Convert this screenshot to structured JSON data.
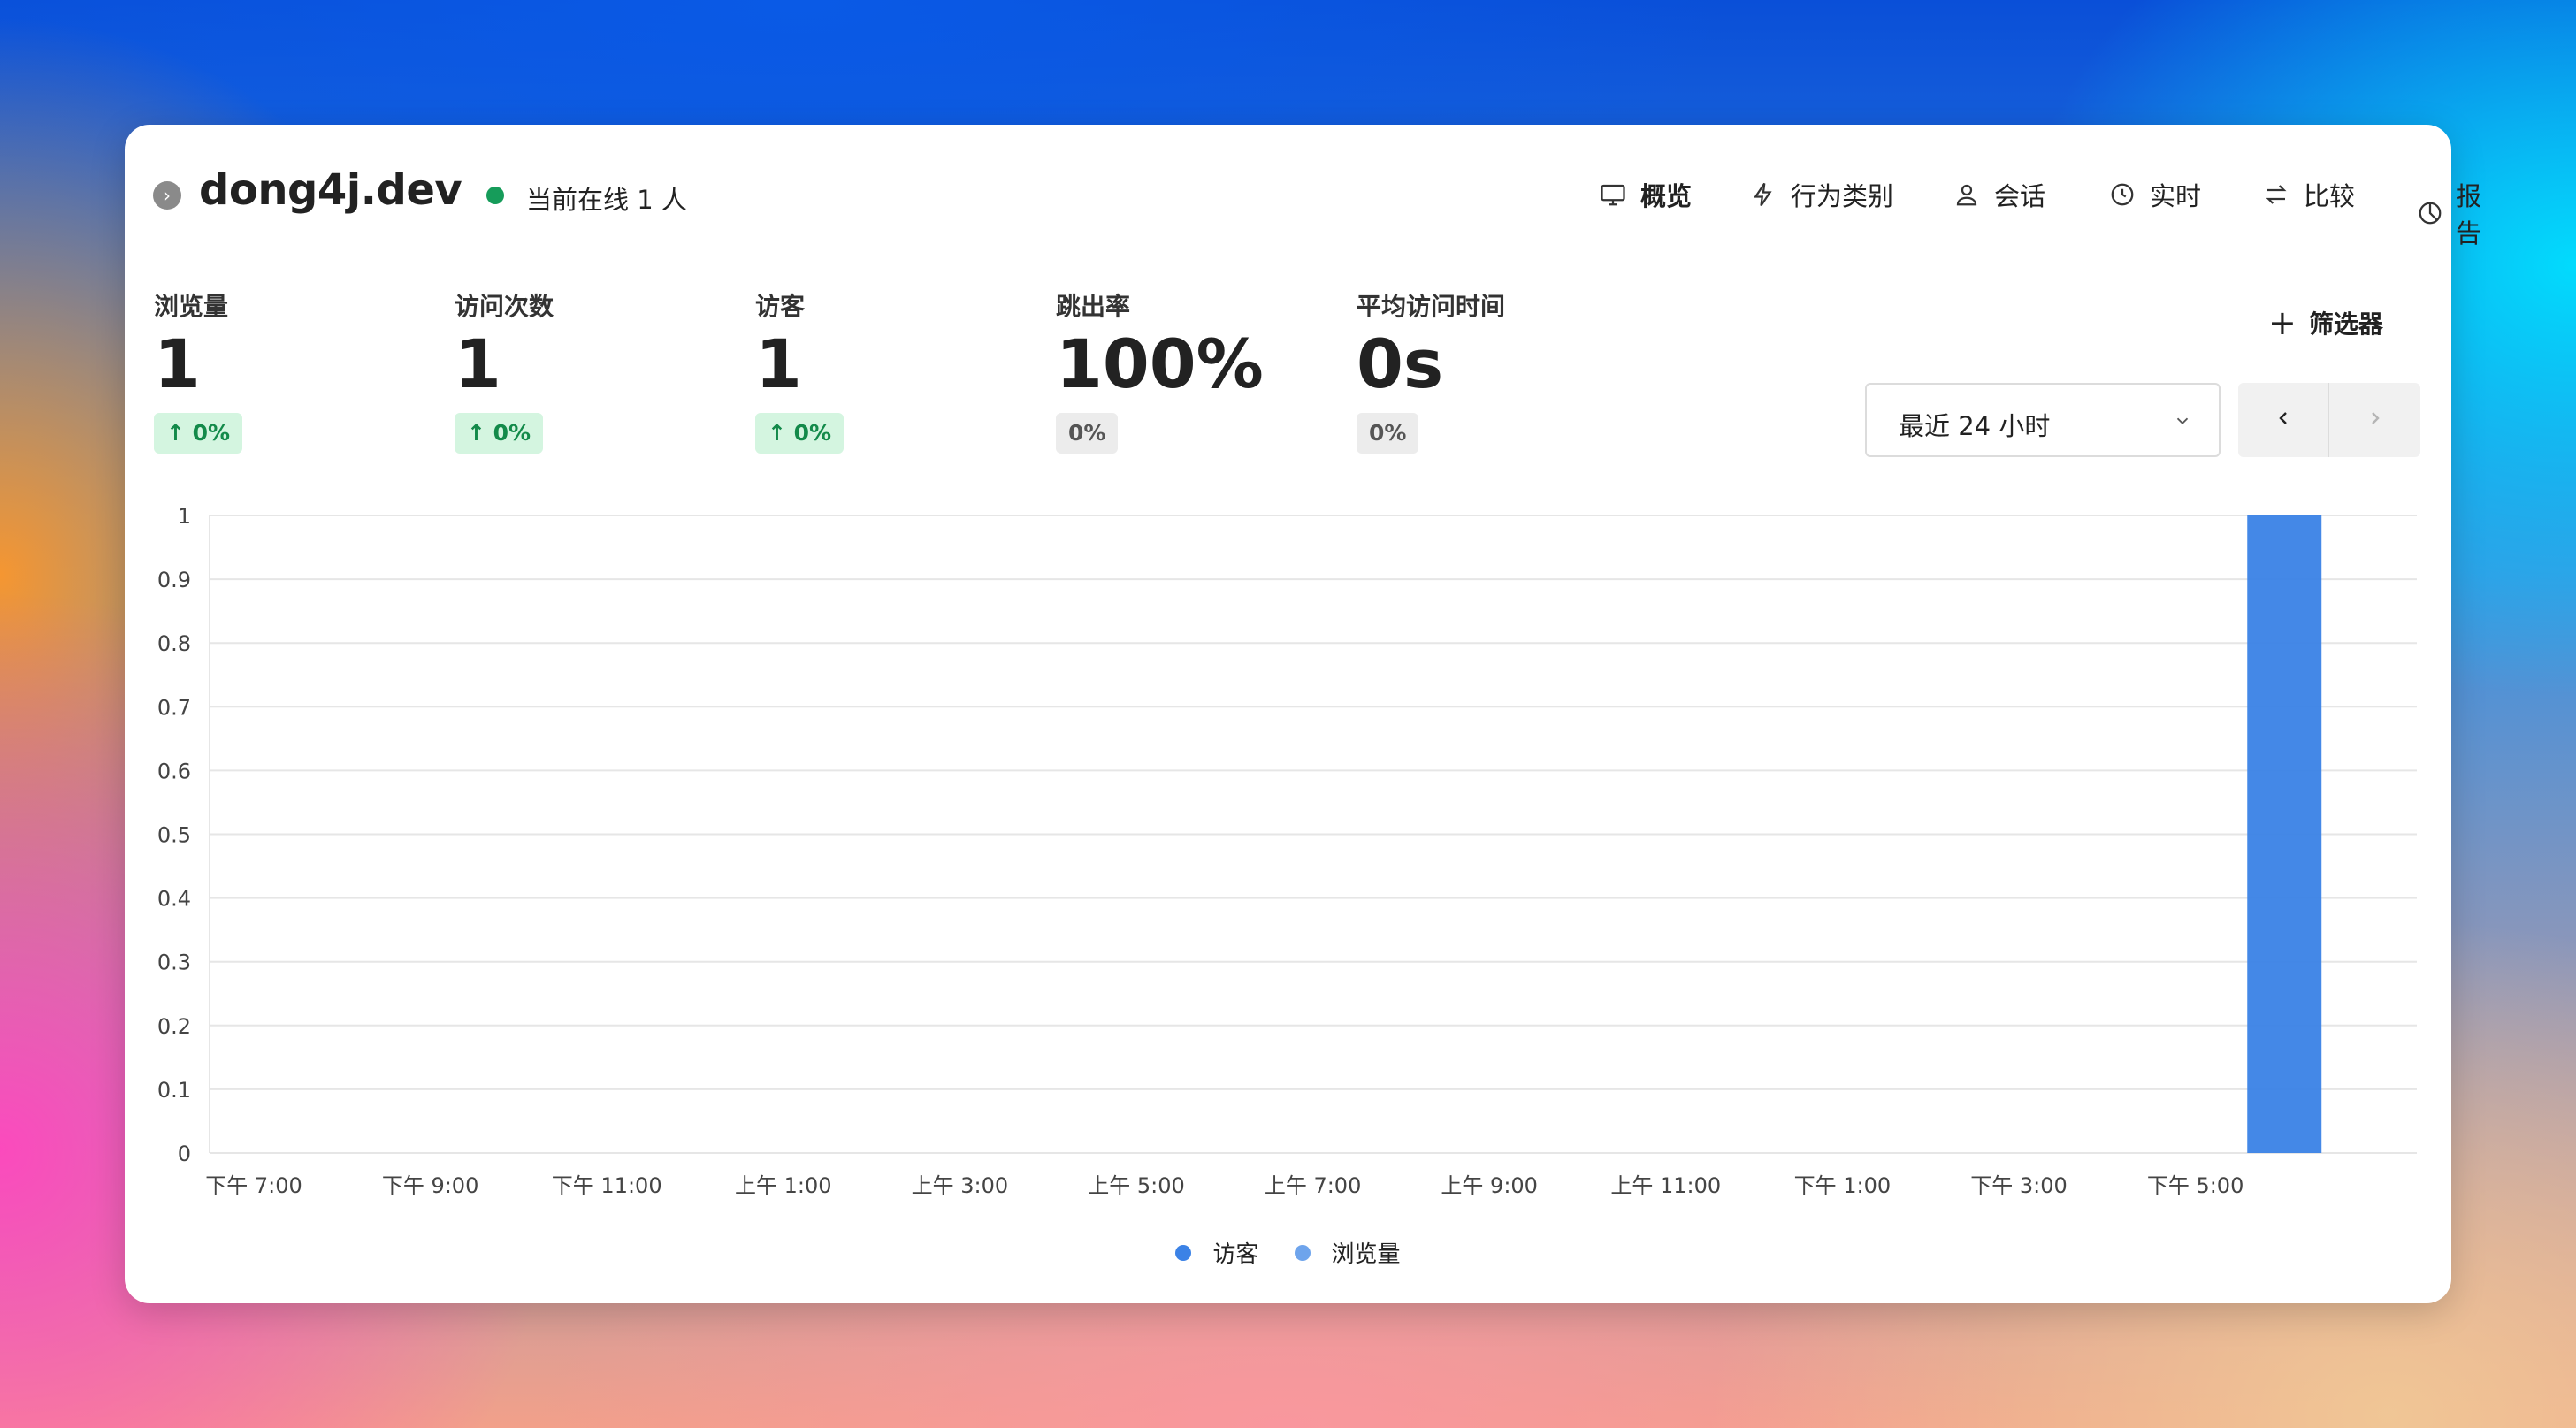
{
  "header": {
    "site_name": "dong4j.dev",
    "online_text": "当前在线 1 人",
    "online_color": "#169c5a",
    "nav": [
      {
        "label": "概览",
        "icon": "monitor-icon",
        "active": true
      },
      {
        "label": "行为类别",
        "icon": "lightning-icon",
        "active": false
      },
      {
        "label": "会话",
        "icon": "user-icon",
        "active": false
      },
      {
        "label": "实时",
        "icon": "clock-icon",
        "active": false
      },
      {
        "label": "比较",
        "icon": "swap-arrows-icon",
        "active": false
      },
      {
        "label": "报告",
        "icon": "pie-chart-icon",
        "active": false
      }
    ]
  },
  "metrics": [
    {
      "label": "浏览量",
      "value": "1",
      "change": "0%",
      "trend": "up"
    },
    {
      "label": "访问次数",
      "value": "1",
      "change": "0%",
      "trend": "up"
    },
    {
      "label": "访客",
      "value": "1",
      "change": "0%",
      "trend": "up"
    },
    {
      "label": "跳出率",
      "value": "100%",
      "change": "0%",
      "trend": "flat"
    },
    {
      "label": "平均访问时间",
      "value": "0s",
      "change": "0%",
      "trend": "flat"
    }
  ],
  "filter": {
    "label": "筛选器"
  },
  "date_range": {
    "value": "最近 24 小时"
  },
  "colors": {
    "visitors": "#3b82e6",
    "views": "#6ea4ec"
  },
  "chart_data": {
    "type": "bar",
    "ylim": [
      0,
      1
    ],
    "yticks": [
      "0",
      "0.1",
      "0.2",
      "0.3",
      "0.4",
      "0.5",
      "0.6",
      "0.7",
      "0.8",
      "0.9",
      "1"
    ],
    "xticks": [
      "下午 7:00",
      "下午 9:00",
      "下午 11:00",
      "上午 1:00",
      "上午 3:00",
      "上午 5:00",
      "上午 7:00",
      "上午 9:00",
      "上午 11:00",
      "下午 1:00",
      "下午 3:00",
      "下午 5:00"
    ],
    "bucket_count": 25,
    "series": [
      {
        "name": "访客",
        "values": [
          0,
          0,
          0,
          0,
          0,
          0,
          0,
          0,
          0,
          0,
          0,
          0,
          0,
          0,
          0,
          0,
          0,
          0,
          0,
          0,
          0,
          0,
          0,
          1,
          0
        ]
      },
      {
        "name": "浏览量",
        "values": [
          0,
          0,
          0,
          0,
          0,
          0,
          0,
          0,
          0,
          0,
          0,
          0,
          0,
          0,
          0,
          0,
          0,
          0,
          0,
          0,
          0,
          0,
          0,
          1,
          0
        ]
      }
    ],
    "legend": [
      "访客",
      "浏览量"
    ],
    "legend_position": "bottom",
    "grid": true
  }
}
